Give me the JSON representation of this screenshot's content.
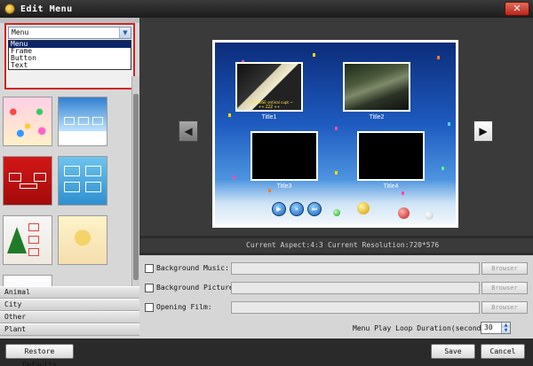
{
  "window": {
    "title": "Edit Menu",
    "close_label": "✕"
  },
  "left_panel": {
    "dropdown": {
      "selected": "Menu",
      "options": [
        "Menu",
        "Frame",
        "Button",
        "Text"
      ]
    },
    "categories": [
      "Animal",
      "City",
      "Other",
      "Plant"
    ]
  },
  "preview": {
    "titles": [
      "Title1",
      "Title2",
      "Title3",
      "Title4"
    ],
    "thumb1_caption": "~ DNTSBSE ontinal cupt ~",
    "thumb1_subcaption": "++ ZZZ ++"
  },
  "info": {
    "aspect": "Current Aspect:4:3",
    "resolution": "Current Resolution:720*576"
  },
  "settings": {
    "background_music_label": "Background Music:",
    "background_picture_label": "Background Picture:",
    "opening_film_label": "Opening Film:",
    "browse_label": "Browser",
    "loop_duration_label": "Menu Play Loop Duration(seconds):",
    "loop_duration_value": "30"
  },
  "buttons": {
    "restore": "Restore Defaults",
    "save": "Save",
    "cancel": "Cancel"
  },
  "colors": {
    "highlight_border": "#d42222",
    "selection": "#0a246a",
    "menu_bg": "#1e5bc0"
  }
}
